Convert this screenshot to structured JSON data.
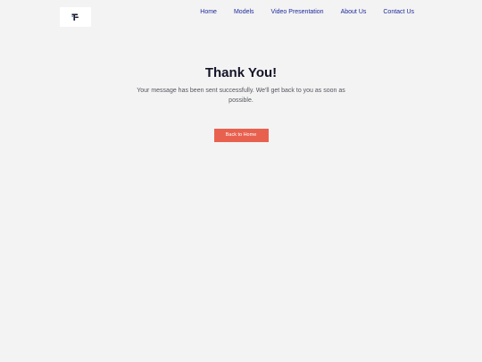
{
  "header": {
    "logo_icon": "brand-logo-icon",
    "nav": [
      {
        "label": "Home"
      },
      {
        "label": "Models"
      },
      {
        "label": "Video Presentation"
      },
      {
        "label": "About Us"
      },
      {
        "label": "Contact Us"
      }
    ]
  },
  "main": {
    "title": "Thank You!",
    "message": "Your message has been sent successfully. We'll get back to you as soon as possible.",
    "button_label": "Back to Home"
  },
  "colors": {
    "background": "#f3f3f3",
    "nav_link": "#1f2a9c",
    "title": "#141428",
    "button": "#e8614f"
  }
}
